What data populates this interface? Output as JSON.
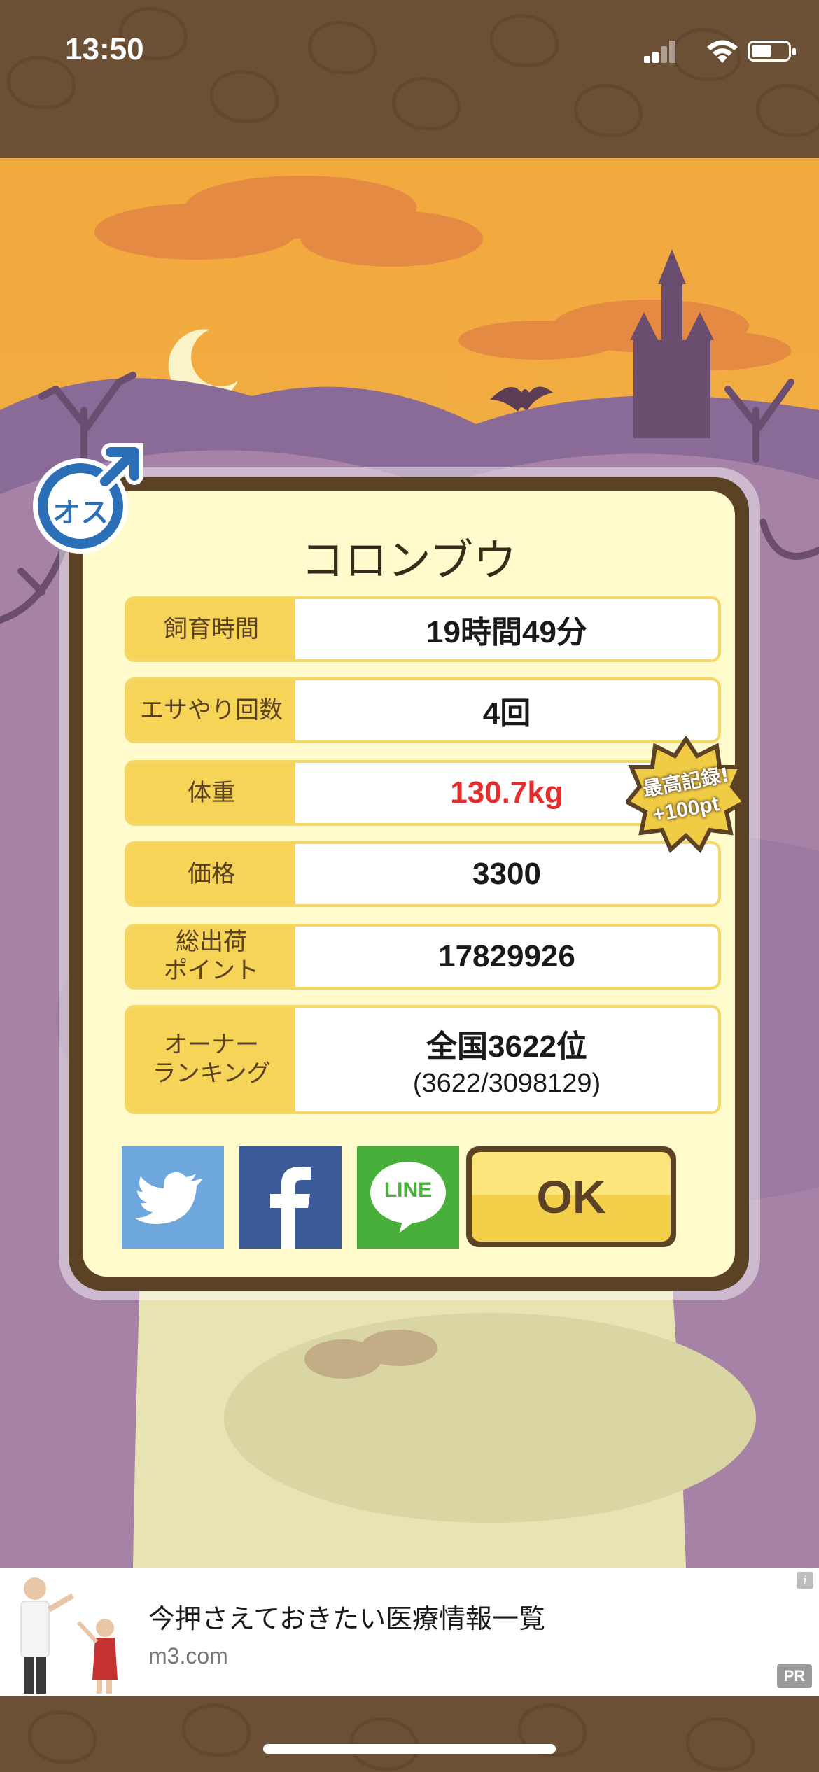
{
  "status_bar": {
    "time": "13:50"
  },
  "dialog": {
    "title": "コロンブウ",
    "rows": [
      {
        "label": "飼育時間",
        "value": "19時間49分"
      },
      {
        "label": "エサやり回数",
        "value": "4回"
      },
      {
        "label": "体重",
        "value": "130.7kg"
      },
      {
        "label": "価格",
        "value": "3300"
      },
      {
        "label": "総出荷\nポイント",
        "value": "17829926"
      },
      {
        "label": "オーナー\nランキング",
        "value": "全国3622位",
        "sub": "(3622/3098129)"
      }
    ],
    "record_badge": {
      "line1": "最高記録!",
      "line2": "+100pt"
    },
    "gender_badge": {
      "text": "オス"
    },
    "share": {
      "line_label": "LINE"
    },
    "ok_label": "OK"
  },
  "ad": {
    "title": "今押さえておきたい医療情報一覧",
    "url": "m3.com",
    "pr_label": "PR",
    "info_label": "i"
  },
  "colors": {
    "sky": "#f2a93e",
    "hill_purple": "#a582a6",
    "panel_bg": "#fffbcc",
    "label_bg": "#f5d457",
    "frame_brown": "#5b4225",
    "weight_red": "#e52d2d",
    "twitter_blue": "#6ea7de",
    "facebook_blue": "#3a5a98",
    "line_green": "#48b03a"
  }
}
